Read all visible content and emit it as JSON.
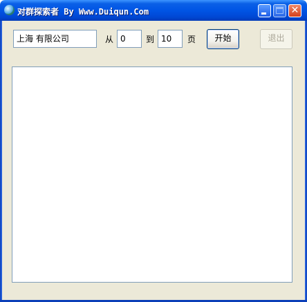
{
  "window": {
    "title": "对群探索者 By Www.Duiqun.Com",
    "app_icon": "globe-icon",
    "buttons": {
      "minimize": "minimize-icon",
      "maximize": "maximize-icon",
      "close": "close-icon"
    },
    "colors": {
      "titlebar": "#0055e5",
      "client_bg": "#ece9d8",
      "input_border": "#7f9db9"
    }
  },
  "search": {
    "keyword_value": "上海 有限公司",
    "from_label": "从",
    "from_value": "0",
    "to_label": "到",
    "to_value": "10",
    "page_label": "页"
  },
  "actions": {
    "start_label": "开始",
    "exit_label": "退出",
    "exit_disabled": true
  },
  "results": {
    "items": []
  }
}
